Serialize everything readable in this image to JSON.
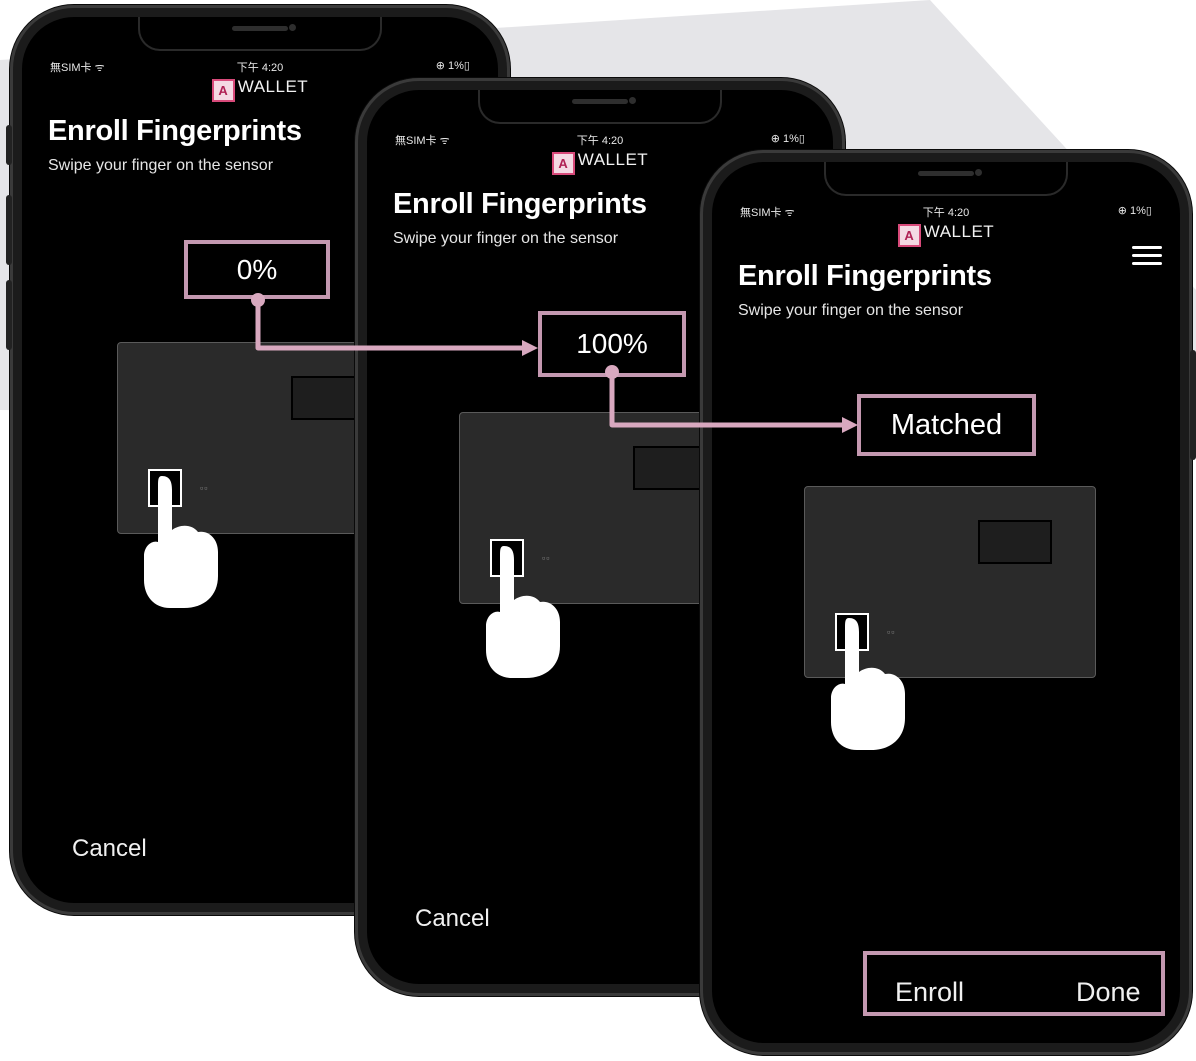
{
  "colors": {
    "accent": "#c498b0",
    "connector": "#d8a8bf",
    "background_shape": "#e5e5e8",
    "screen": "#000000",
    "logo_pink": "#d84a7a"
  },
  "phones": [
    {
      "status": {
        "carrier": "無SIM卡 ᯤ",
        "time": "下午 4:20",
        "battery": "⊕ 1%▯"
      },
      "logo": {
        "mark": "A",
        "text": "WALLET"
      },
      "title": "Enroll Fingerprints",
      "subtitle": "Swipe your finger on the sensor",
      "cancel_label": "Cancel",
      "card_dots": "▫▫",
      "icons": [
        "finger-pointer-icon",
        "logo-icon"
      ]
    },
    {
      "status": {
        "carrier": "無SIM卡 ᯤ",
        "time": "下午 4:20",
        "battery": "⊕ 1%▯"
      },
      "logo": {
        "mark": "A",
        "text": "WALLET"
      },
      "title": "Enroll Fingerprints",
      "subtitle": "Swipe your finger on the sensor",
      "cancel_label": "Cancel",
      "card_dots": "▫▫",
      "icons": [
        "finger-pointer-icon",
        "logo-icon"
      ]
    },
    {
      "status": {
        "carrier": "無SIM卡 ᯤ",
        "time": "下午 4:20",
        "battery": "⊕ 1%▯"
      },
      "logo": {
        "mark": "A",
        "text": "WALLET"
      },
      "title": "Enroll Fingerprints",
      "subtitle": "Swipe your finger on the sensor",
      "enroll_label": "Enroll",
      "done_label": "Done",
      "card_dots": "▫▫",
      "icons": [
        "finger-pointer-icon",
        "logo-icon",
        "hamburger-menu-icon"
      ]
    }
  ],
  "callouts": {
    "progress_start": "0%",
    "progress_end": "100%",
    "result": "Matched"
  }
}
